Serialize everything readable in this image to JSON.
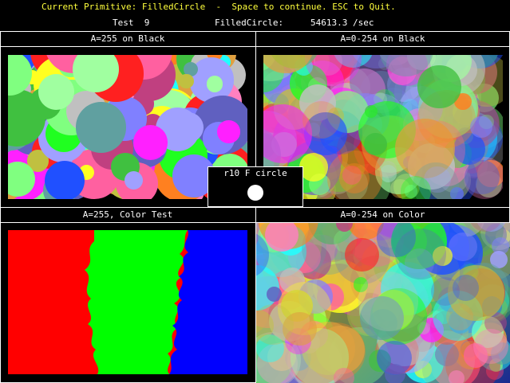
{
  "header": {
    "current_primitive_line": "Current Primitive: FilledCircle  -  Space to continue. ESC to Quit.",
    "test_label": "Test  9",
    "rate_label": "FilledCircle:",
    "rate_value": "54613.3 /sec"
  },
  "panels": {
    "top_left": {
      "title": "A=255 on Black"
    },
    "top_right": {
      "title": "A=0-254 on Black"
    },
    "bottom_left": {
      "title": "A=255, Color Test"
    },
    "bottom_right": {
      "title": "A=0-254 on Color"
    }
  },
  "popup": {
    "label": "r10 F circle"
  },
  "colors": {
    "header_text": "#ffff3c",
    "red": "#ff0000",
    "green": "#00ff00",
    "blue": "#0000ff",
    "border": "#ffffff"
  }
}
